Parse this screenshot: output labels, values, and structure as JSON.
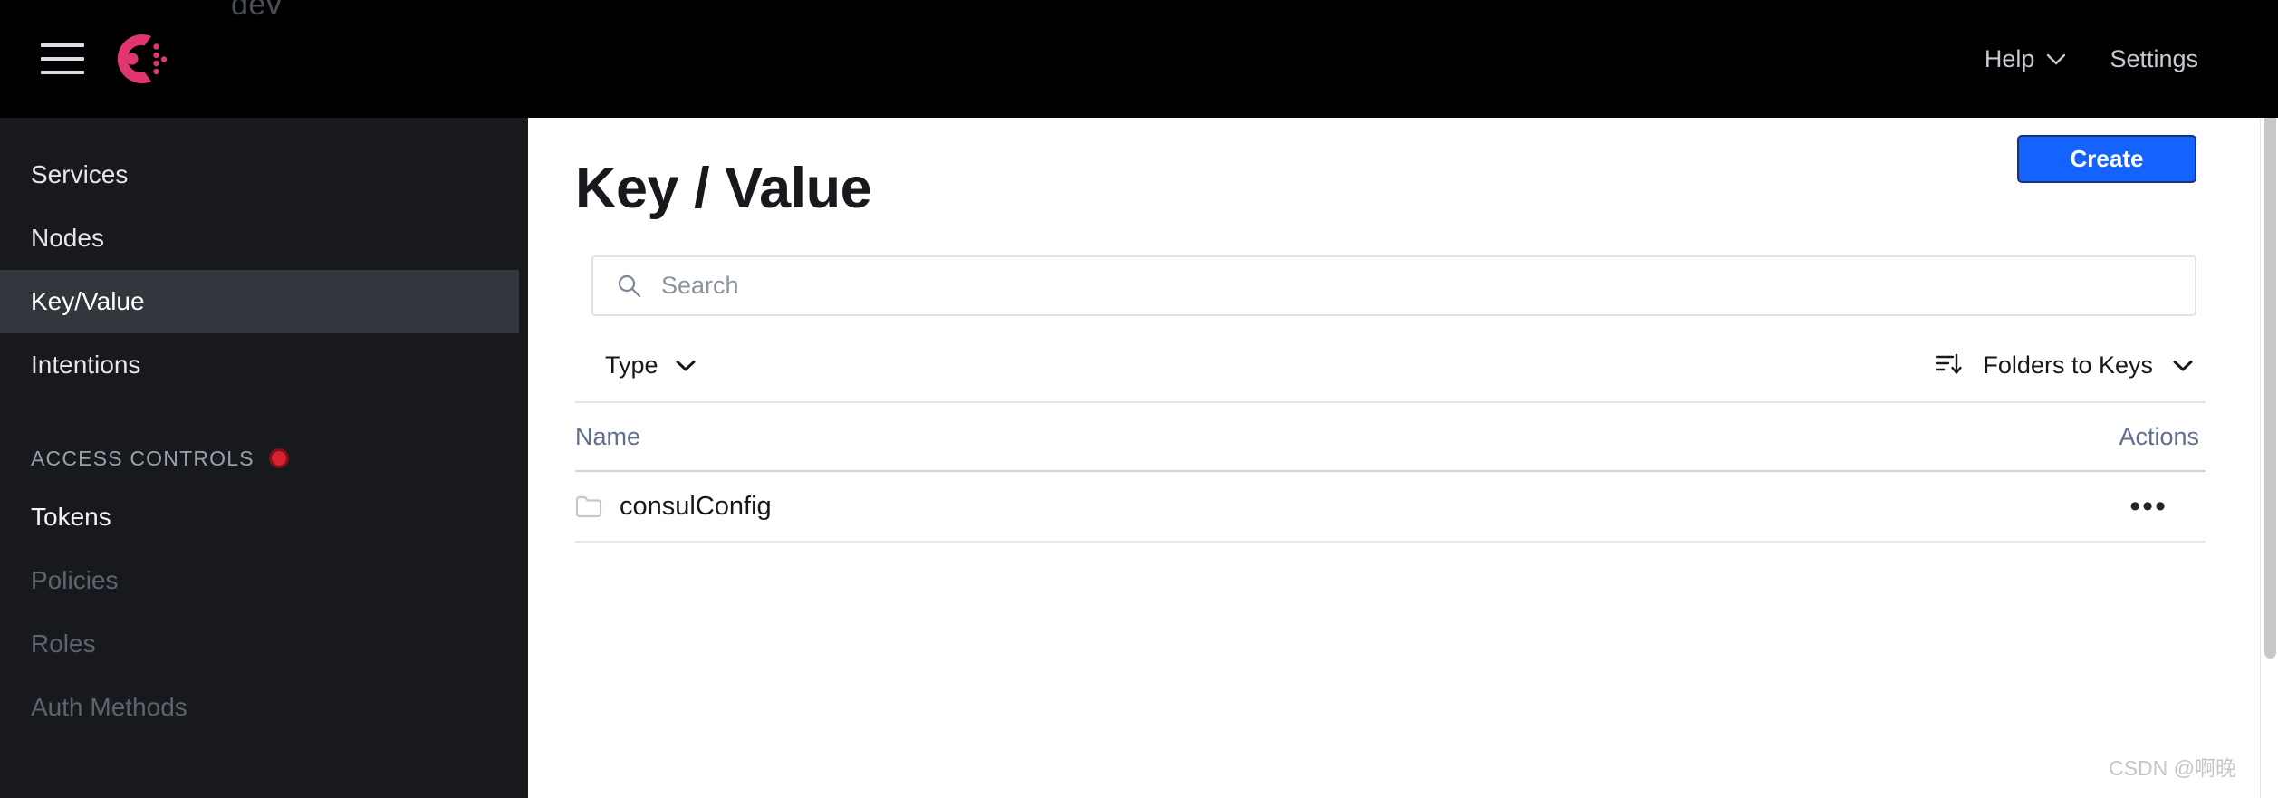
{
  "topbar": {
    "cutoff_text": "dev",
    "menu_icon": "hamburger-menu-icon",
    "logo_icon": "consul-logo-icon",
    "help_label": "Help",
    "settings_label": "Settings",
    "background_color": "#000000"
  },
  "sidebar": {
    "background_color": "#17191d",
    "active_background_color": "#33363c",
    "items": [
      {
        "label": "Services",
        "state": "normal"
      },
      {
        "label": "Nodes",
        "state": "normal"
      },
      {
        "label": "Key/Value",
        "state": "active"
      },
      {
        "label": "Intentions",
        "state": "normal"
      }
    ],
    "section": {
      "label": "ACCESS CONTROLS",
      "indicator_icon": "red-dot-icon",
      "indicator_color": "#d9202f"
    },
    "acl_items": [
      {
        "label": "Tokens",
        "state": "bright"
      },
      {
        "label": "Policies",
        "state": "dim"
      },
      {
        "label": "Roles",
        "state": "dim"
      },
      {
        "label": "Auth Methods",
        "state": "dim"
      }
    ]
  },
  "main": {
    "page_title": "Key / Value",
    "create_button": {
      "label": "Create",
      "color": "#1563ff"
    },
    "search": {
      "placeholder": "Search",
      "value": "",
      "icon": "search-icon"
    },
    "filters": {
      "type_label": "Type",
      "type_chevron_icon": "chevron-down-icon",
      "sort_icon": "sort-descending-icon",
      "sort_label": "Folders to Keys",
      "sort_chevron_icon": "chevron-down-icon"
    },
    "table": {
      "columns": [
        "Name",
        "Actions"
      ],
      "rows": [
        {
          "icon": "folder-icon",
          "name": "consulConfig",
          "actions_label": "•••"
        }
      ]
    }
  },
  "watermark": "CSDN @啊晚"
}
